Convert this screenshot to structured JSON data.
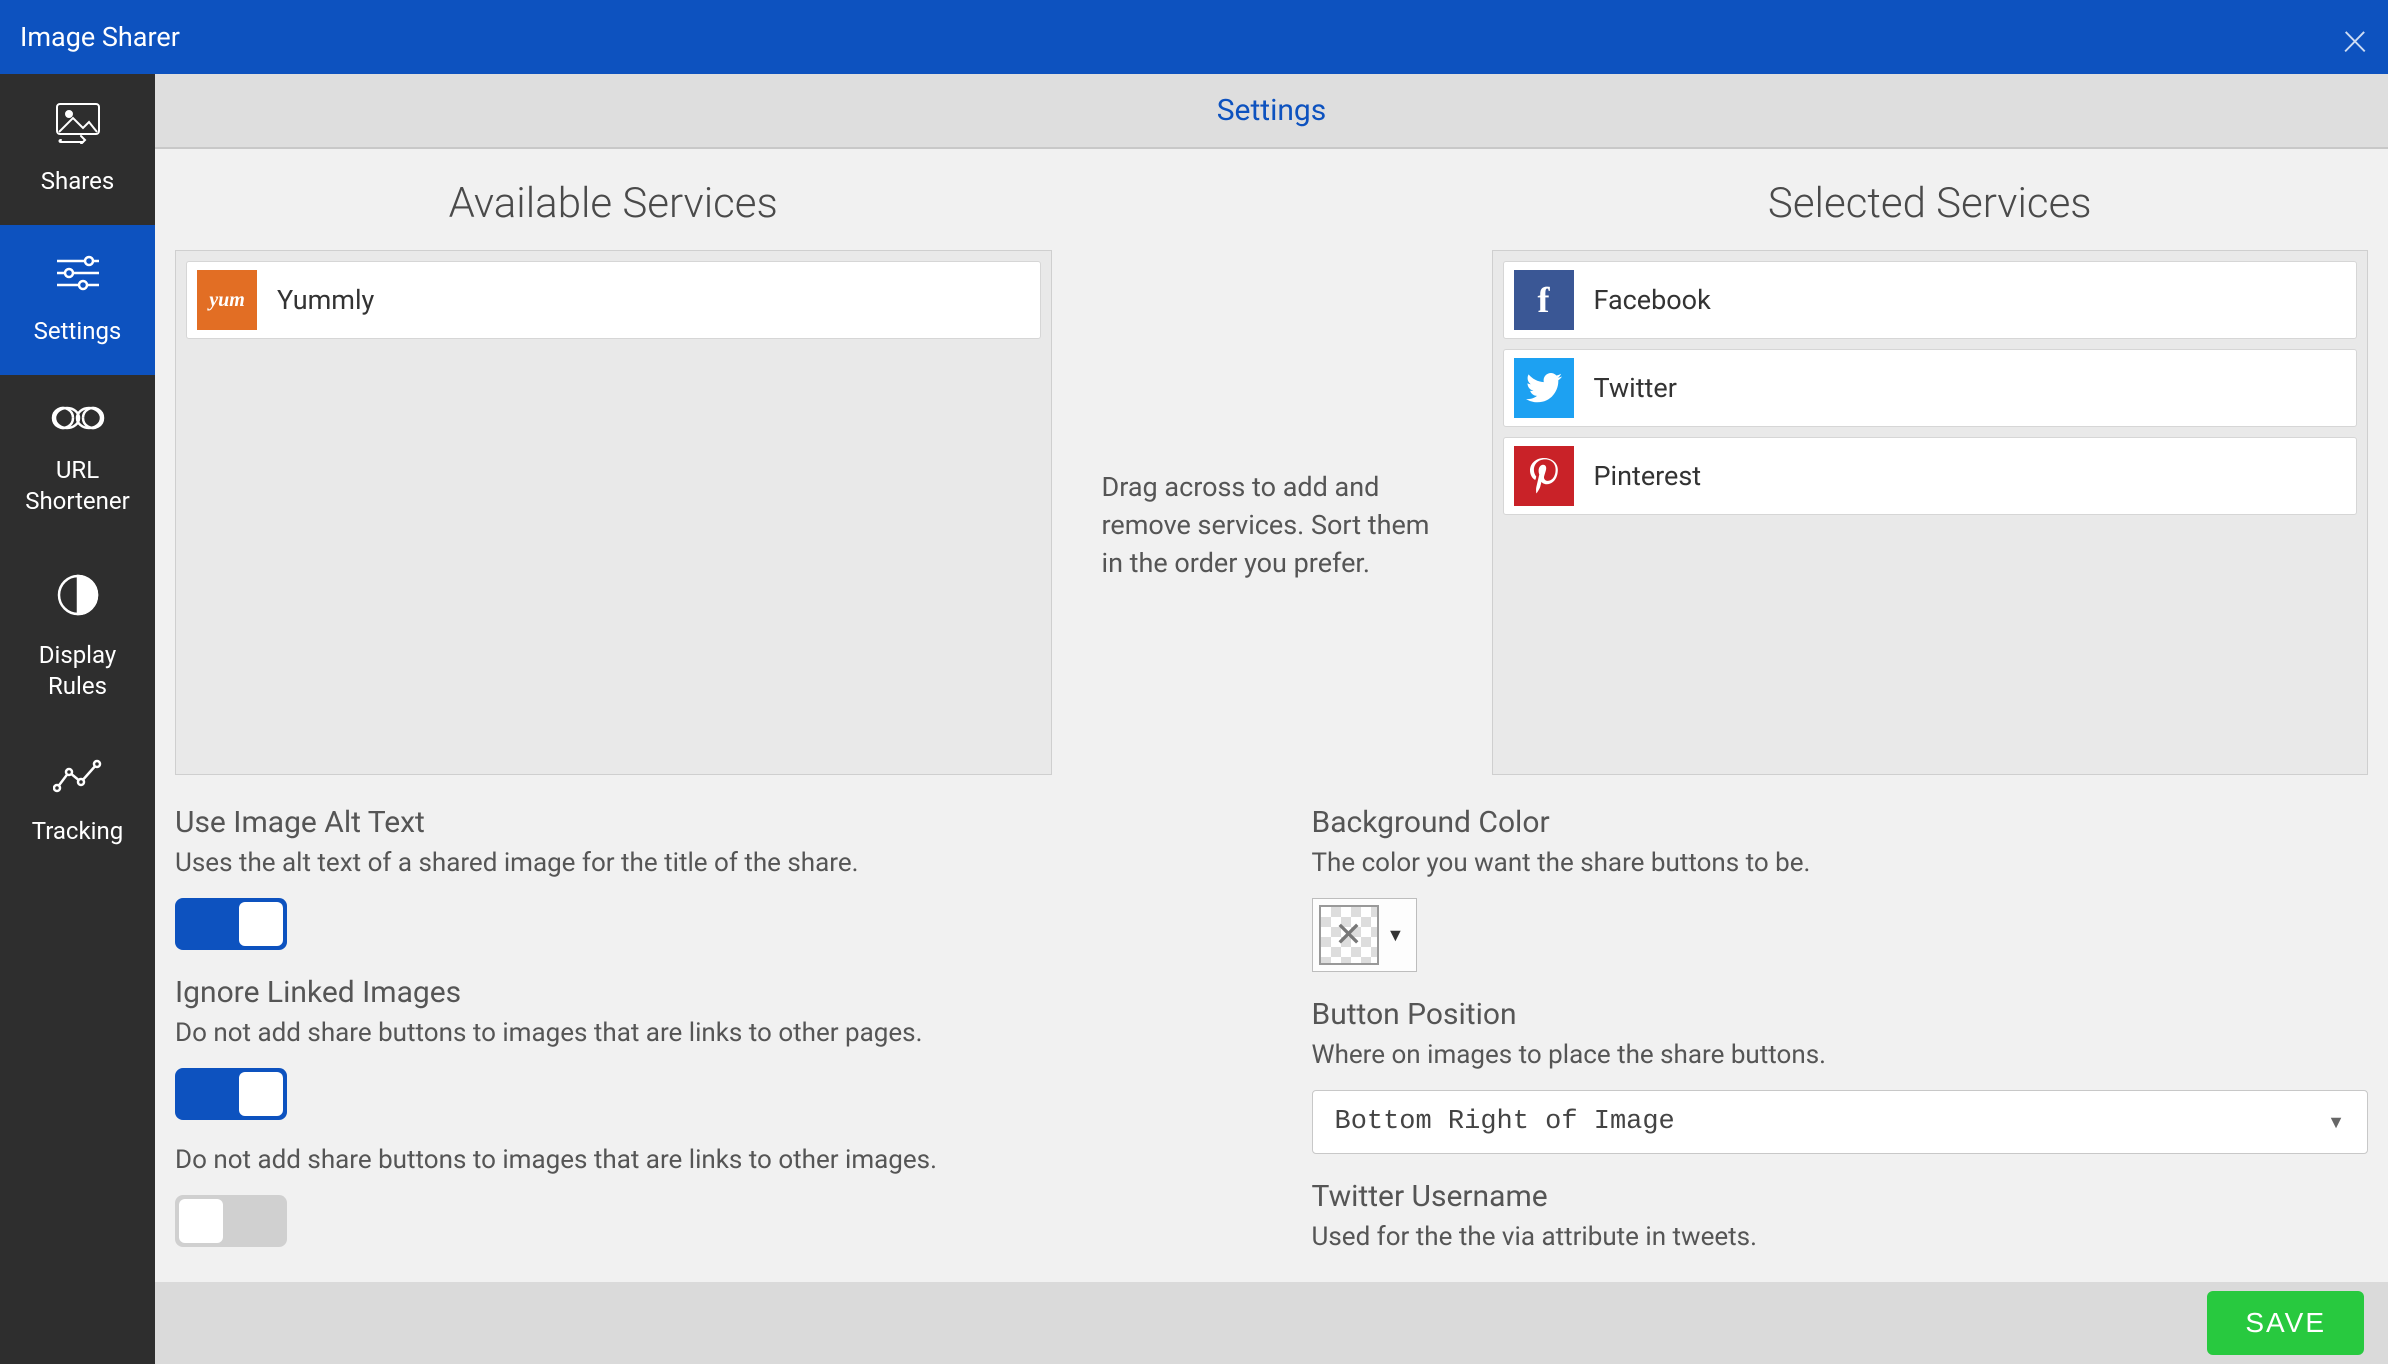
{
  "titlebar": {
    "title": "Image Sharer"
  },
  "sidebar": {
    "items": [
      {
        "label": "Shares"
      },
      {
        "label": "Settings"
      },
      {
        "label": "URL Shortener"
      },
      {
        "label": "Display Rules"
      },
      {
        "label": "Tracking"
      }
    ]
  },
  "tabs": {
    "active": "Settings"
  },
  "services": {
    "available_title": "Available Services",
    "selected_title": "Selected Services",
    "available": [
      {
        "name": "Yummly"
      }
    ],
    "selected": [
      {
        "name": "Facebook"
      },
      {
        "name": "Twitter"
      },
      {
        "name": "Pinterest"
      }
    ],
    "help_text": "Drag across to add and remove services. Sort them in the order you prefer."
  },
  "settings": {
    "alt_text": {
      "title": "Use Image Alt Text",
      "desc": "Uses the alt text of a shared image for the title of the share.",
      "on": true
    },
    "ignore_linked": {
      "title": "Ignore Linked Images",
      "desc_pages": "Do not add share buttons to images that are links to other pages.",
      "desc_images": "Do not add share buttons to images that are links to other images.",
      "on_pages": true,
      "on_images": false
    },
    "bg_color": {
      "title": "Background Color",
      "desc": "The color you want the share buttons to be."
    },
    "button_pos": {
      "title": "Button Position",
      "desc": "Where on images to place the share buttons.",
      "value": "Bottom Right of Image"
    },
    "twitter_user": {
      "title": "Twitter Username",
      "desc": "Used for the the via attribute in tweets."
    }
  },
  "footer": {
    "save": "SAVE"
  }
}
